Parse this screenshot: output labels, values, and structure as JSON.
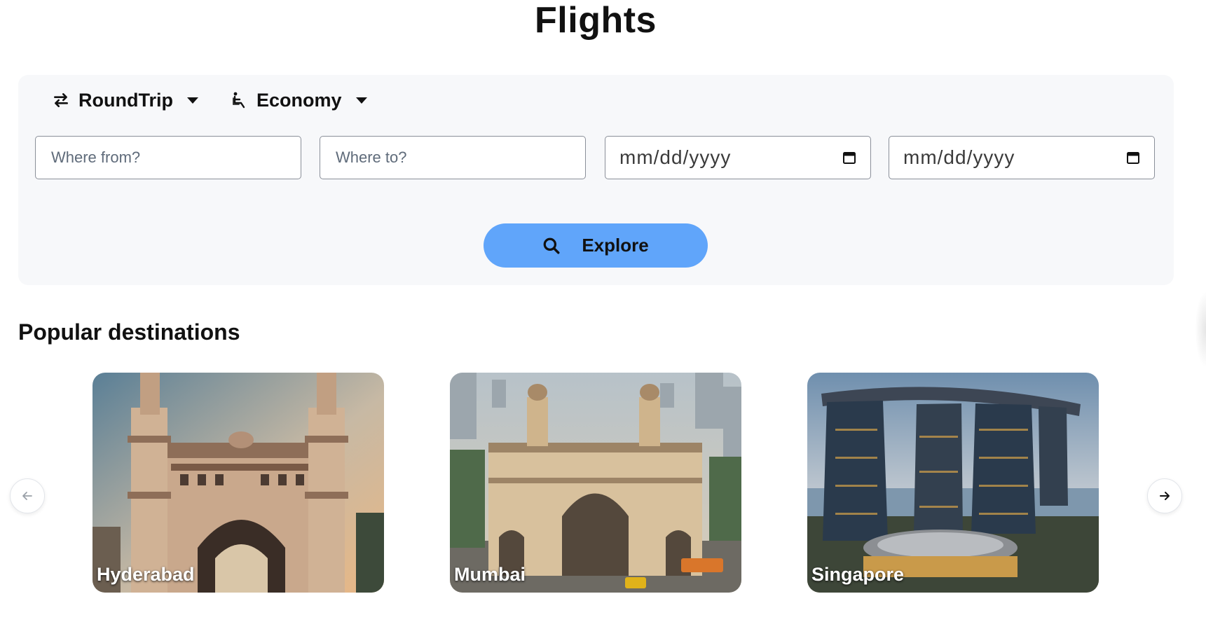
{
  "page": {
    "title": "Flights"
  },
  "search": {
    "trip_type": "RoundTrip",
    "cabin_class": "Economy",
    "from_placeholder": "Where from?",
    "to_placeholder": "Where to?",
    "depart_placeholder": "mm/dd/yyyy",
    "return_placeholder": "mm/dd/yyyy",
    "explore_label": "Explore"
  },
  "popular": {
    "title": "Popular destinations",
    "destinations": [
      {
        "name": "Hyderabad"
      },
      {
        "name": "Mumbai"
      },
      {
        "name": "Singapore"
      }
    ]
  },
  "icons": {
    "trip_type": "swap-arrows-icon",
    "cabin_class": "seat-icon",
    "calendar": "calendar-icon",
    "search": "search-icon",
    "prev": "arrow-left-icon",
    "next": "arrow-right-icon"
  },
  "colors": {
    "accent": "#60a5fa",
    "panel_bg": "#f7f8fa"
  }
}
